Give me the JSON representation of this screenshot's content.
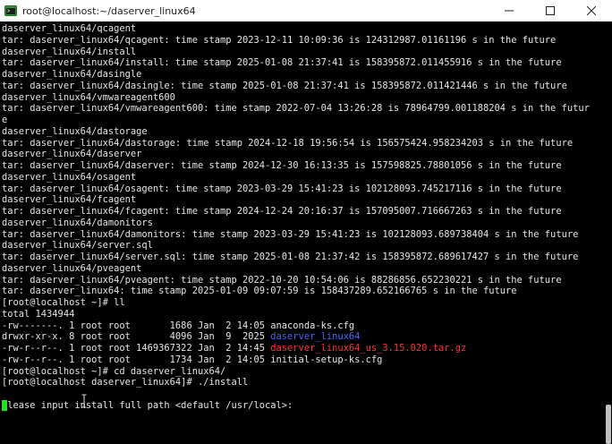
{
  "window": {
    "title": "root@localhost:~/daserver_linux64",
    "minimize_icon": "minimize-icon",
    "maximize_icon": "maximize-icon",
    "close_icon": "close-icon"
  },
  "terminal": {
    "lines": [
      "daserver_linux64/qcagent",
      "tar: daserver_linux64/qcagent: time stamp 2023-12-11 10:09:36 is 124312987.01161196 s in the future",
      "daserver_linux64/install",
      "tar: daserver_linux64/install: time stamp 2025-01-08 21:37:41 is 158395872.011455916 s in the future",
      "daserver_linux64/dasingle",
      "tar: daserver_linux64/dasingle: time stamp 2025-01-08 21:37:41 is 158395872.011421446 s in the future",
      "daserver_linux64/vmwareagent600",
      "tar: daserver_linux64/vmwareagent600: time stamp 2022-07-04 13:26:28 is 78964799.001188204 s in the futur",
      "e",
      "daserver_linux64/dastorage",
      "tar: daserver_linux64/dastorage: time stamp 2024-12-18 19:56:54 is 156575424.958234203 s in the future",
      "daserver_linux64/daserver",
      "tar: daserver_linux64/daserver: time stamp 2024-12-30 16:13:35 is 157598825.78801056 s in the future",
      "daserver_linux64/osagent",
      "tar: daserver_linux64/osagent: time stamp 2023-03-29 15:41:23 is 102128093.745217116 s in the future",
      "daserver_linux64/fcagent",
      "tar: daserver_linux64/fcagent: time stamp 2024-12-24 20:16:37 is 157095007.716667263 s in the future",
      "daserver_linux64/damonitors",
      "tar: daserver_linux64/damonitors: time stamp 2023-03-29 15:41:23 is 102128093.689738404 s in the future",
      "daserver_linux64/server.sql",
      "tar: daserver_linux64/server.sql: time stamp 2025-01-08 21:37:42 is 158395872.689617427 s in the future",
      "daserver_linux64/pveagent",
      "tar: daserver_linux64/pveagent: time stamp 2022-10-20 10:54:06 is 88286856.652230221 s in the future",
      "tar: daserver_linux64: time stamp 2025-01-09 09:07:59 is 158437289.652166765 s in the future",
      "[root@localhost ~]# ll",
      "total 1434944"
    ],
    "listing": [
      {
        "prefix": "-rw-------. 1 root root       1686 Jan  2 14:05 ",
        "name": "anaconda-ks.cfg",
        "color": "#e5e5e5"
      },
      {
        "prefix": "drwxr-xr-x. 8 root root       4096 Jan  9  2025 ",
        "name": "daserver_linux64",
        "color": "#4b64ff"
      },
      {
        "prefix": "-rw-r--r--. 1 root root 1469367322 Jan  2 14:45 ",
        "name": "daserver_linux64_us_3.15.020.tar.gz",
        "color": "#ff3333"
      },
      {
        "prefix": "-rw-r--r--. 1 root root       1734 Jan  2 14:05 ",
        "name": "initial-setup-ks.cfg",
        "color": "#e5e5e5"
      }
    ],
    "after_lines": [
      "[root@localhost ~]# cd daserver_linux64/",
      "[root@localhost daserver_linux64]# ./install",
      "",
      "Please input install full path <default /usr/local>:"
    ]
  }
}
